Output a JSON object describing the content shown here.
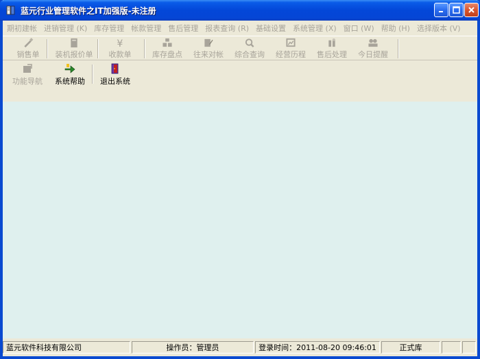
{
  "window": {
    "title": "蓝元行业管理软件之IT加强版-未注册"
  },
  "menu": [
    {
      "label": "期初建帐"
    },
    {
      "label": "进销管理 (K)"
    },
    {
      "label": "库存管理"
    },
    {
      "label": "帐款管理"
    },
    {
      "label": "售后管理"
    },
    {
      "label": "报表查询 (R)"
    },
    {
      "label": "基础设置"
    },
    {
      "label": "系统管理 (X)"
    },
    {
      "label": "窗口 (W)"
    },
    {
      "label": "帮助 (H)"
    },
    {
      "label": "选择版本 (V)"
    }
  ],
  "toolbar": {
    "sales_order": "销售单",
    "assembly_quote": "装机报价单",
    "receipt": "收款单",
    "inventory_check": "库存盘点",
    "account_reconcile": "往来对帐",
    "general_query": "综合查询",
    "business_history": "经营历程",
    "after_sales": "售后处理",
    "today_reminder": "今日提醒"
  },
  "toolbar2": {
    "function_nav": "功能导航",
    "system_help": "系统帮助",
    "exit_system": "退出系统"
  },
  "status": {
    "company": "蓝元软件科技有限公司",
    "operator": "操作员：管理员",
    "login_time": "登录时间：2011-08-20 09:46:01",
    "db": "正式库"
  },
  "colors": {
    "titlebar": "#0347d8",
    "client_bg": "#dff0ee",
    "disabled_text": "#a8a49a"
  }
}
